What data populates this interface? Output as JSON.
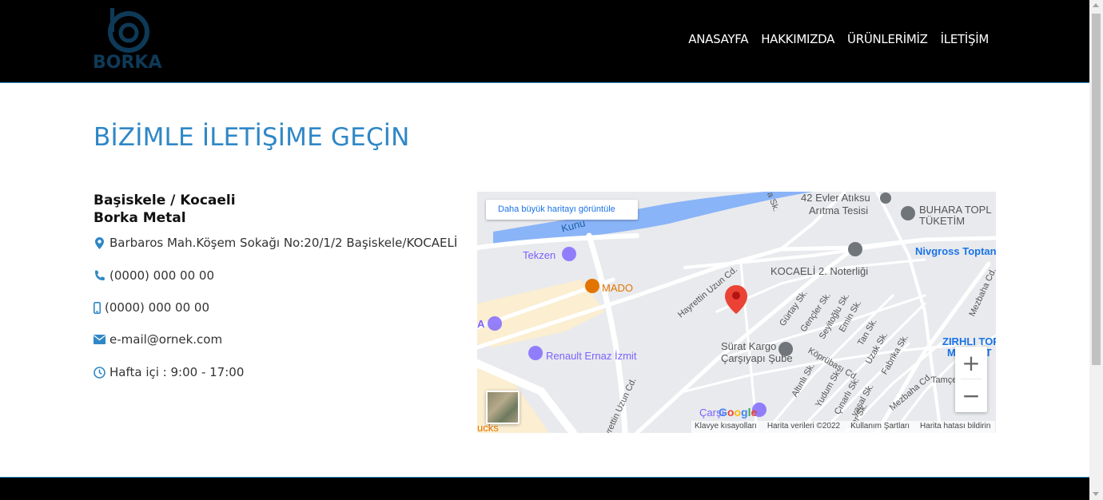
{
  "header": {
    "logo_text": "BORKA",
    "nav": [
      "ANASAYFA",
      "HAKKIMIZDA",
      "ÜRÜNLERİMİZ",
      "İLETİŞİM"
    ]
  },
  "main": {
    "title": "BİZİMLE İLETİŞİME GEÇİN",
    "contact": {
      "city": "Başiskele / Kocaeli",
      "company": "Borka Metal",
      "address": "Barbaros Mah.Köşem Sokağı No:20/1/2 Başiskele/KOCAELİ",
      "phone": "(0000) 000 00 00",
      "mobile": "(0000) 000 00 00",
      "email": "e-mail@ornek.com",
      "hours": "Hafta içi : 9:00 - 17:00"
    }
  },
  "map": {
    "tooltip": "Daha büyük haritayı görüntüle",
    "labels": {
      "evler": "42 Evler Atıksu",
      "aritma": "Arıtma Tesisi",
      "buhara": "BUHARA TOPL",
      "tuketim": "TÜKETİM",
      "tekzen": "Tekzen",
      "mado": "MADO",
      "kocaeli": "KOCAELİ 2. Noterliği",
      "nivgross": "Nivgross Toptan",
      "surat": "Sürat Kargo",
      "carsi": "Çarşıyapı Şube",
      "renault": "Renault Ernaz İzmit",
      "zirhli": "ZIRHLI TOPTAN",
      "market": "MARKET",
      "carsi2": "Çarşı",
      "kunu": "Kunu",
      "hayrettin1": "Hayrettin Uzun Cd.",
      "hayrettin2": "Hayrettin Uzun Cd.",
      "mezbaha1": "Mezbaha Cd.",
      "mezbaha2": "Mezbaha Cd.",
      "gurtay": "Gürtay Sk.",
      "gencler": "Gençler Sk.",
      "seyitoglu": "Seyitoğlu Sk.",
      "emin": "Emin Sk.",
      "tan": "Tan Sk.",
      "uzak": "Uzak Sk.",
      "fabrika": "Fabrika Sk.",
      "koprubasi": "Köprübaşı Cd.",
      "altinli": "Altınlı Sk.",
      "yudum": "Yudum Sk.",
      "cinarli": "Çınarlı Sk.",
      "yasal": "yasal Sk.",
      "var": "var Sk.",
      "tamce": "Tamçe",
      "ra": "ra Sk.",
      "a": "A",
      "ucks": "ucks"
    },
    "zoom_in": "+",
    "zoom_out": "−",
    "google": "Google",
    "attribution": [
      "Klavye kısayolları",
      "Harita verileri ©2022",
      "Kullanım Şartları",
      "Harita hatası bildirin"
    ]
  },
  "colors": {
    "accent": "#2f87c6",
    "header_bg": "#000000",
    "pin": "#ea4335"
  }
}
